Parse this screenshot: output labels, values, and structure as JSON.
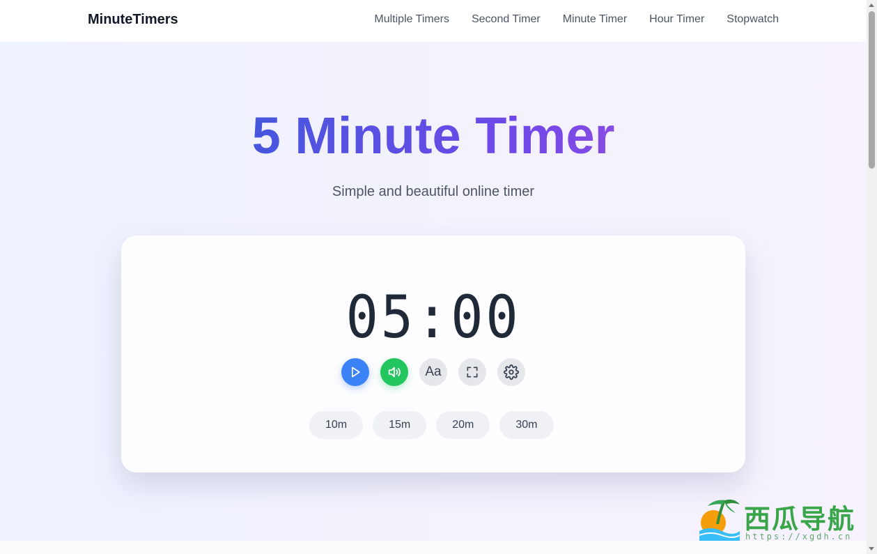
{
  "nav": {
    "brand": "MinuteTimers",
    "links": [
      "Multiple Timers",
      "Second Timer",
      "Minute Timer",
      "Hour Timer",
      "Stopwatch"
    ]
  },
  "hero": {
    "title": "5 Minute Timer",
    "subtitle": "Simple and beautiful online timer"
  },
  "timer": {
    "display": "05:00",
    "controls": {
      "play_icon": "play-icon",
      "sound_icon": "volume-icon",
      "font_label": "Aa",
      "fullscreen_icon": "fullscreen-icon",
      "settings_icon": "gear-icon"
    },
    "presets": [
      "10m",
      "15m",
      "20m",
      "30m"
    ]
  },
  "watermark": {
    "text": "西瓜导航",
    "url": "https://xgdh.cn"
  },
  "colors": {
    "primary": "#3b82f6",
    "success": "#22c55e",
    "title_gradient_start": "#3b5bdb",
    "title_gradient_end": "#9b4fe0"
  }
}
